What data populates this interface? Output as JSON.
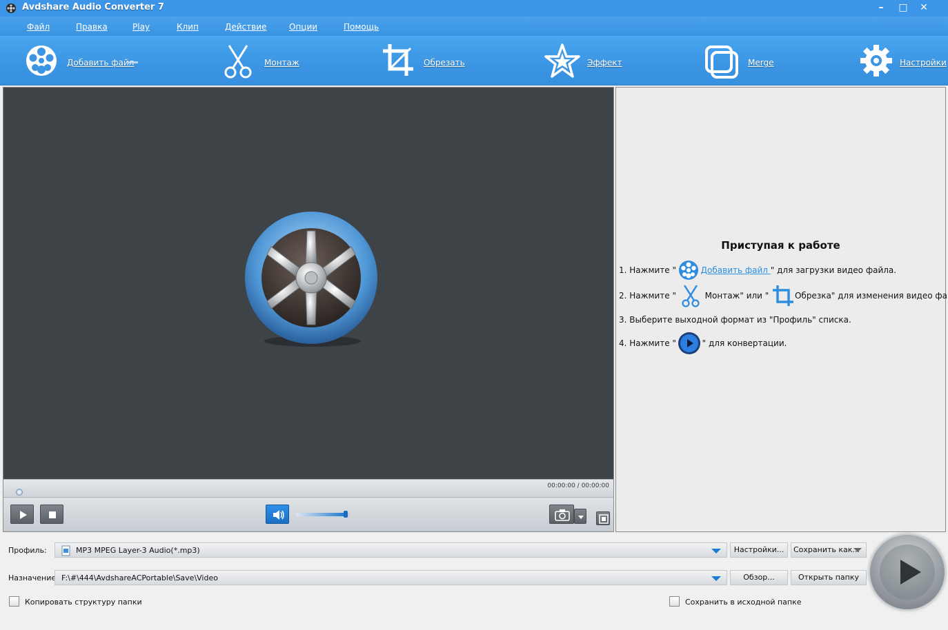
{
  "window": {
    "title": "Avdshare Audio Converter 7",
    "minimize": "–",
    "maximize": "□",
    "close": "✕"
  },
  "menu": [
    "Файл",
    "Правка",
    "Play",
    "Клип",
    "Действие",
    "Опции",
    "Помощь"
  ],
  "toolbar": {
    "add_file": "Добавить файл",
    "edit": "Монтаж",
    "crop": "Обрезать",
    "effect": "Эффект",
    "merge": "Merge",
    "settings": "Настройки"
  },
  "player": {
    "time": "00:00:00 / 00:00:00",
    "volume_level": 0.92,
    "seek_position": 0.0
  },
  "guide": {
    "title": "Приступая к работе",
    "step1_prefix": "1. Нажмите \"",
    "step1_link": " Добавить файл ",
    "step1_suffix": "\" для загрузки видео файла.",
    "step2_prefix": "2. Нажмите \"",
    "step2_middle": " Монтаж\" или \"",
    "step2_suffix": " Обрезка\" для изменения видео файла.",
    "step3": "3. Выберите выходной формат из \"Профиль\" списка.",
    "step4_prefix": "4. Нажмите \"",
    "step4_suffix": "\" для конвертации."
  },
  "bottom": {
    "profile_label": "Профиль:",
    "profile_value": "MP3 MPEG Layer-3 Audio(*.mp3)",
    "settings_button": "Настройки...",
    "save_as_button": "Сохранить как...",
    "destination_label": "Назначение:",
    "destination_value": "F:\\#\\444\\AvdshareACPortable\\Save\\Video",
    "browse_button": "Обзор...",
    "open_folder_button": "Открыть папку",
    "copy_structure_label": "Копировать структуру папки",
    "save_in_source_label": "Сохранить в исходной папке"
  },
  "colors": {
    "accent": "#3c95e6",
    "preview_bg": "#3e4347",
    "link": "#2b8fe0"
  }
}
